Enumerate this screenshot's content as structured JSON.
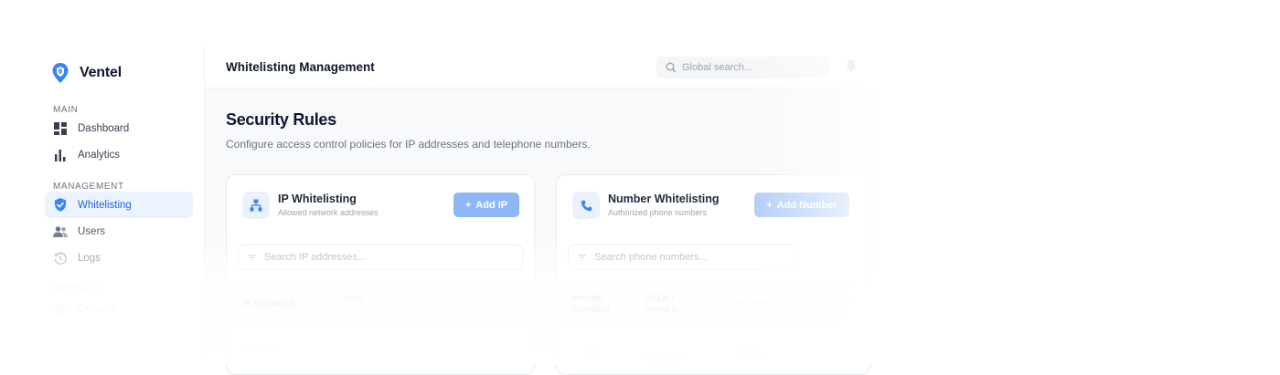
{
  "brand": {
    "name": "Ventel",
    "logo_icon": "location-shield-icon",
    "accent": "#2563eb"
  },
  "sidebar": {
    "sections": [
      {
        "label": "MAIN",
        "items": [
          {
            "label": "Dashboard",
            "icon": "dashboard-icon"
          },
          {
            "label": "Analytics",
            "icon": "bar-chart-icon"
          }
        ]
      },
      {
        "label": "MANAGEMENT",
        "items": [
          {
            "label": "Whitelisting",
            "icon": "shield-check-icon",
            "active": true
          },
          {
            "label": "Users",
            "icon": "users-icon"
          },
          {
            "label": "Logs",
            "icon": "history-icon"
          }
        ]
      },
      {
        "label": "SETTINGS",
        "items": [
          {
            "label": "General",
            "icon": "gear-icon"
          }
        ]
      }
    ]
  },
  "topbar": {
    "title": "Whitelisting Management",
    "search_placeholder": "Global search...",
    "bell_icon": "bell-icon"
  },
  "page": {
    "title": "Security Rules",
    "subtitle": "Configure access control policies for IP addresses and telephone numbers."
  },
  "ip_card": {
    "title": "IP Whitelisting",
    "subtitle": "Allowed network addresses",
    "button": "Add IP",
    "search_placeholder": "Search IP addresses...",
    "columns": [
      "IP ADDRESS",
      "LABEL"
    ],
    "rows": [
      [
        "192.168",
        ""
      ]
    ]
  },
  "number_card": {
    "title": "Number Whitelisting",
    "subtitle": "Authorized phone numbers",
    "button": "Add Number",
    "search_placeholder": "Search phone numbers...",
    "columns": [
      "PHONE NUMBER",
      "USER / OWNER",
      "STATUS",
      "ACTIONS"
    ],
    "rows": [
      [
        "+1",
        "(Support)",
        "Active",
        ""
      ]
    ]
  }
}
